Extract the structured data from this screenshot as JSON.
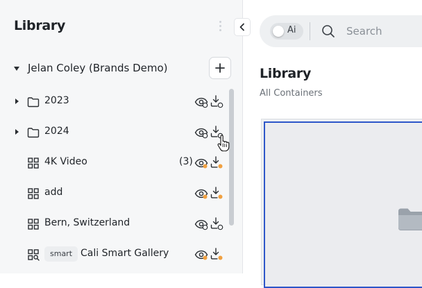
{
  "sidebar": {
    "title": "Library",
    "root": {
      "label": "Jelan Coley (Brands Demo)",
      "expanded": true
    },
    "items": [
      {
        "label": "2023",
        "type": "folder",
        "expandable": true,
        "count": "",
        "badge": ""
      },
      {
        "label": "2024",
        "type": "folder",
        "expandable": true,
        "count": "",
        "badge": ""
      },
      {
        "label": "4K Video",
        "type": "gallery",
        "expandable": false,
        "count": "(3)",
        "badge": ""
      },
      {
        "label": "add",
        "type": "gallery",
        "expandable": false,
        "count": "",
        "badge": ""
      },
      {
        "label": "Bern, Switzerland",
        "type": "gallery",
        "expandable": false,
        "count": "",
        "badge": ""
      },
      {
        "label": "Cali Smart Gallery",
        "type": "smart-gallery",
        "expandable": false,
        "count": "",
        "badge": "smart"
      }
    ]
  },
  "search": {
    "ai_label": "Ai",
    "placeholder": "Search"
  },
  "main": {
    "title": "Library",
    "subtitle": "All Containers"
  },
  "colors": {
    "accent_blue": "#2d56c9",
    "status_orange": "#f0a040",
    "sidebar_bg": "#f6f7f8"
  }
}
